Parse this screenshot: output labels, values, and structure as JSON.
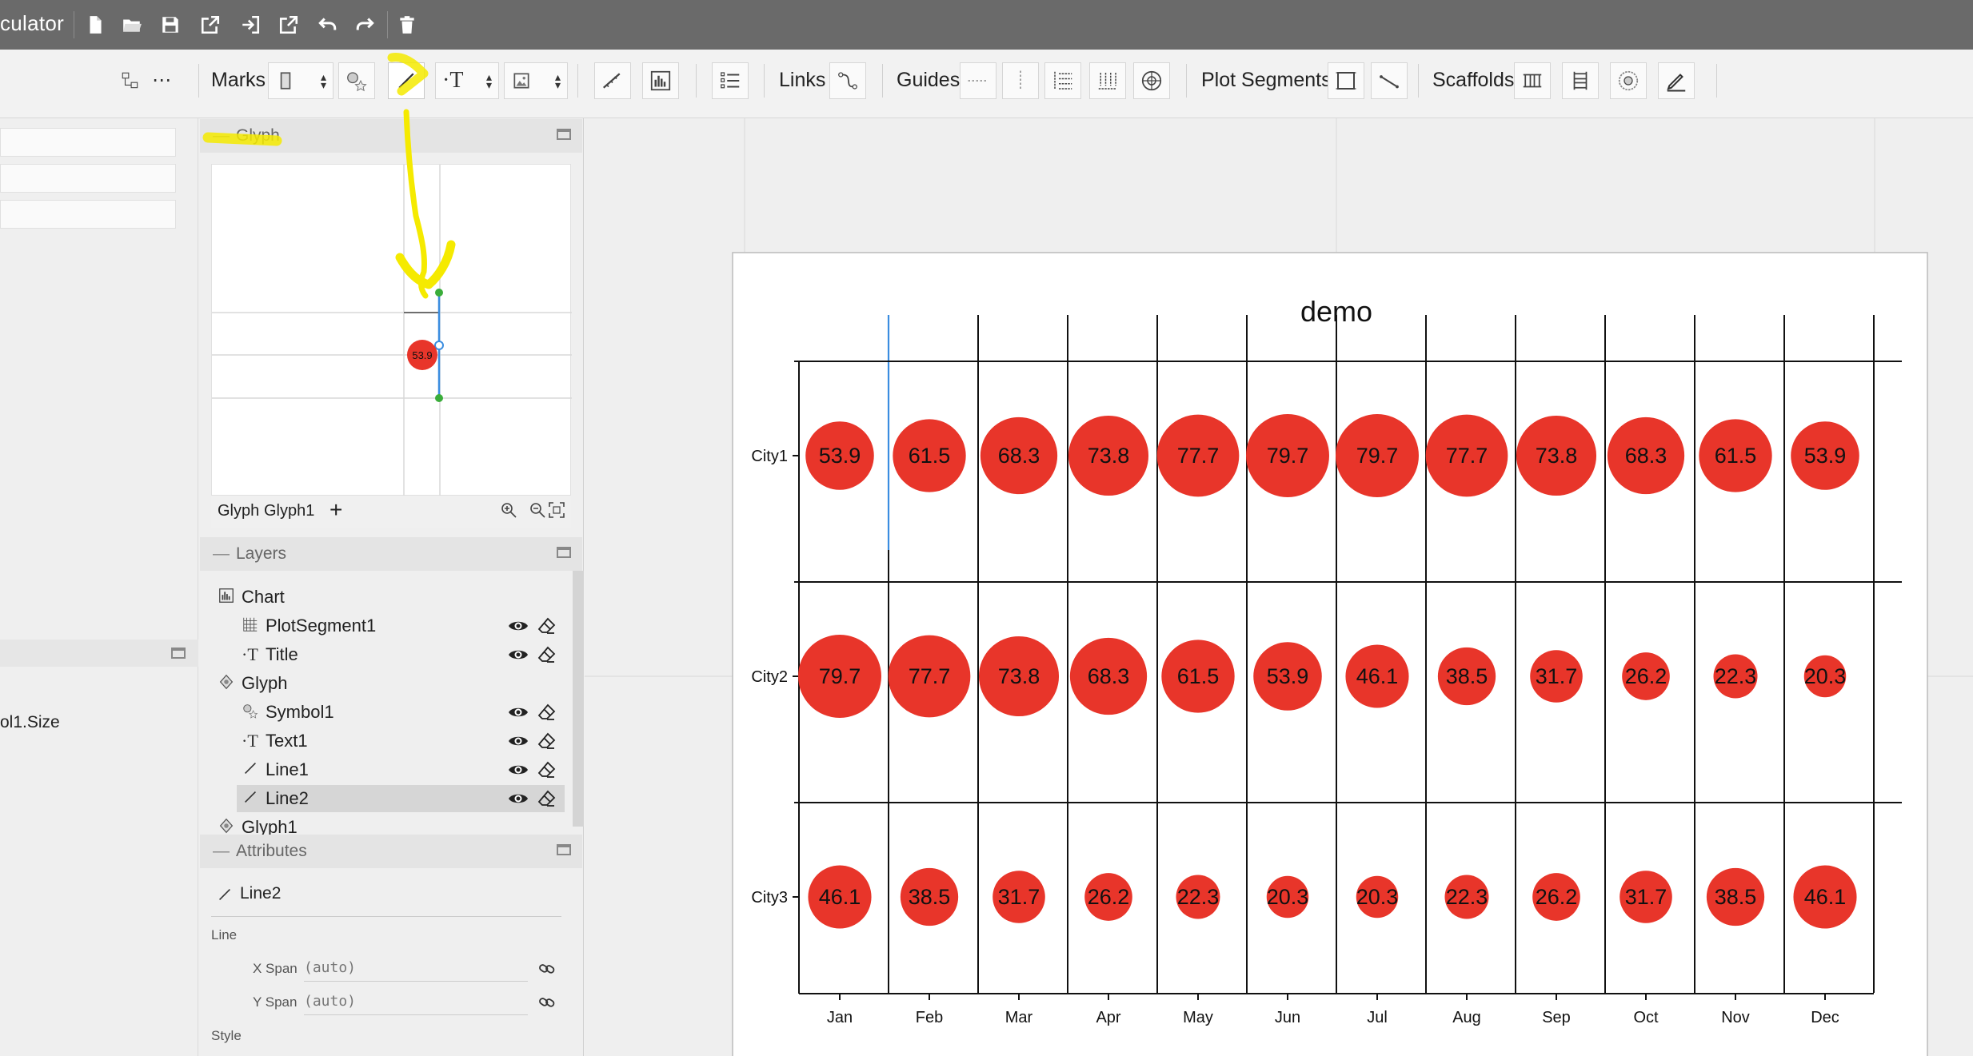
{
  "app": {
    "title": "culator"
  },
  "toolbar": {
    "marks_label": "Marks",
    "links_label": "Links",
    "guides_label": "Guides",
    "plot_segments_label": "Plot Segments",
    "scaffolds_label": "Scaffolds"
  },
  "left_panel": {
    "size_text": "ol1.Size"
  },
  "glyph_panel": {
    "title": "Glyph",
    "preview_value": "53.9",
    "tabs": [
      "Glyph",
      "Glyph1"
    ]
  },
  "layers_panel": {
    "title": "Layers",
    "items": [
      {
        "label": "Chart",
        "icon": "chart-icon",
        "indent": 0,
        "eye": false
      },
      {
        "label": "PlotSegment1",
        "icon": "grid-icon",
        "indent": 1,
        "eye": true
      },
      {
        "label": "Title",
        "icon": "text-icon",
        "indent": 1,
        "eye": true
      },
      {
        "label": "Glyph",
        "icon": "glyph-icon",
        "indent": 0,
        "eye": false
      },
      {
        "label": "Symbol1",
        "icon": "symbol-icon",
        "indent": 1,
        "eye": true
      },
      {
        "label": "Text1",
        "icon": "text-icon",
        "indent": 1,
        "eye": true
      },
      {
        "label": "Line1",
        "icon": "line-icon",
        "indent": 1,
        "eye": true
      },
      {
        "label": "Line2",
        "icon": "line-icon",
        "indent": 1,
        "eye": true,
        "selected": true
      },
      {
        "label": "Glyph1",
        "icon": "glyph-icon",
        "indent": 0,
        "eye": false
      }
    ]
  },
  "attributes_panel": {
    "title": "Attributes",
    "element_name": "Line2",
    "section_line": "Line",
    "x_span_label": "X Span",
    "x_span_value": "(auto)",
    "y_span_label": "Y Span",
    "y_span_value": "(auto)",
    "section_style": "Style"
  },
  "chart_data": {
    "type": "bubble-grid",
    "title": "demo",
    "categories": [
      "Jan",
      "Feb",
      "Mar",
      "Apr",
      "May",
      "Jun",
      "Jul",
      "Aug",
      "Sep",
      "Oct",
      "Nov",
      "Dec"
    ],
    "series": [
      {
        "name": "City1",
        "values": [
          53.9,
          61.5,
          68.3,
          73.8,
          77.7,
          79.7,
          79.7,
          77.7,
          73.8,
          68.3,
          61.5,
          53.9
        ]
      },
      {
        "name": "City2",
        "values": [
          79.7,
          77.7,
          73.8,
          68.3,
          61.5,
          53.9,
          46.1,
          38.5,
          31.7,
          26.2,
          22.3,
          20.3
        ]
      },
      {
        "name": "City3",
        "values": [
          46.1,
          38.5,
          31.7,
          26.2,
          22.3,
          20.3,
          20.3,
          22.3,
          26.2,
          31.7,
          38.5,
          46.1
        ]
      }
    ],
    "bubble_color": "#e8352a",
    "annotation_color": "#f5ea00"
  }
}
